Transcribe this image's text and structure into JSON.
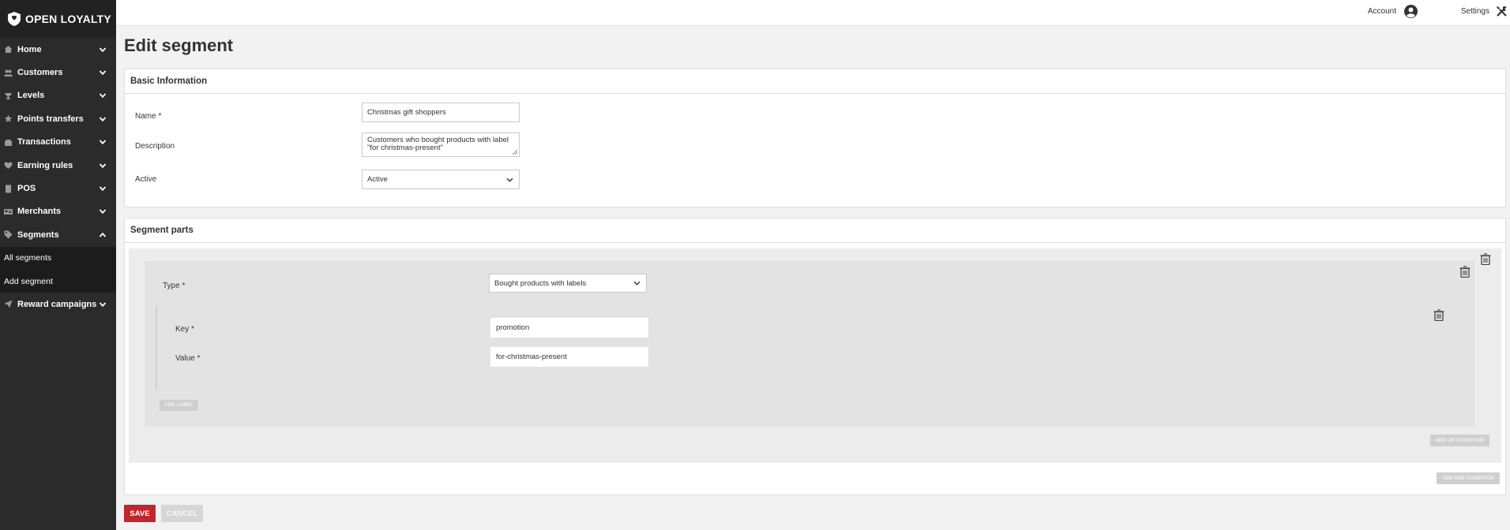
{
  "app": {
    "logo_text": "OPEN LOYALTY"
  },
  "sidebar": {
    "items": [
      {
        "label": "Home",
        "icon": "home-icon"
      },
      {
        "label": "Customers",
        "icon": "customers-icon"
      },
      {
        "label": "Levels",
        "icon": "levels-icon"
      },
      {
        "label": "Points transfers",
        "icon": "star-icon"
      },
      {
        "label": "Transactions",
        "icon": "transactions-icon"
      },
      {
        "label": "Earning rules",
        "icon": "heart-icon"
      },
      {
        "label": "POS",
        "icon": "pos-icon"
      },
      {
        "label": "Merchants",
        "icon": "merchants-icon"
      },
      {
        "label": "Segments",
        "icon": "tag-icon"
      },
      {
        "label": "Reward campaigns",
        "icon": "send-icon"
      }
    ],
    "segments_sub": [
      {
        "label": "All segments"
      },
      {
        "label": "Add segment"
      }
    ]
  },
  "topbar": {
    "account_label": "Account",
    "settings_label": "Settings"
  },
  "page": {
    "title": "Edit segment"
  },
  "basic_info": {
    "heading": "Basic Information",
    "name_label": "Name *",
    "name_value": "Christmas gift shoppers",
    "description_label": "Description",
    "description_value": "Customers who bought products with label\n\"for christmas-present\"",
    "active_label": "Active",
    "active_value": "Active"
  },
  "segment_parts": {
    "heading": "Segment parts",
    "type_label": "Type *",
    "type_value": "Bought products with labels",
    "key_label": "Key *",
    "key_value": "promotion",
    "value_label": "Value *",
    "value_value": "for-christmas-present",
    "add_label_button": "ADD LABEL",
    "add_or_condition_button": "ADD OR CONDITION",
    "add_and_condition_button": "ADD AND CONDITION"
  },
  "actions": {
    "save_label": "SAVE",
    "cancel_label": "CANCEL"
  },
  "colors": {
    "sidebar_bg": "#2b2b2b",
    "save_red": "#c0262d",
    "content_bg": "#f2f2f2"
  }
}
